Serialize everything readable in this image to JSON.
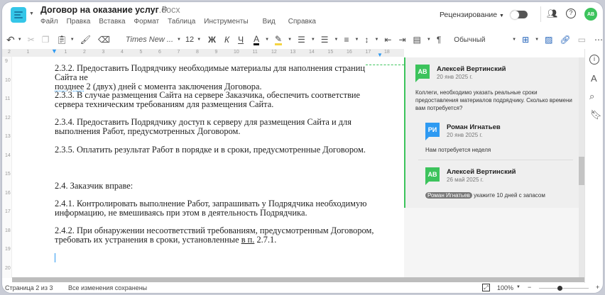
{
  "header": {
    "title": "Договор на оказание услуг",
    "ext": ".docx",
    "review_label": "Рецензирование",
    "user_initials": "АВ"
  },
  "menu": [
    "Файл",
    "Правка",
    "Вставка",
    "Формат",
    "Таблица",
    "Инструменты",
    "Вид",
    "Справка"
  ],
  "toolbar": {
    "font": "Times New ...",
    "size": "12",
    "bold": "Ж",
    "italic": "К",
    "underline": "Ч",
    "color_letter": "A",
    "style": "Обычный",
    "pilcrow": "¶"
  },
  "ruler": [
    "2",
    "1",
    "",
    "1",
    "2",
    "3",
    "4",
    "5",
    "6",
    "7",
    "8",
    "9",
    "10",
    "11",
    "12",
    "13",
    "14",
    "15",
    "16",
    "17",
    "18"
  ],
  "line_numbers": [
    "9",
    "10",
    "11",
    "12",
    "13",
    "14",
    "15",
    "16",
    "17",
    "18",
    "19",
    "20"
  ],
  "document": [
    "2.3.2. Предоставить Подрядчику необходимые материалы для наполнения страниц Сайта не ",
    "2 (двух) дней с момента заключения Договора.",
    "2.3.3. В случае размещения Сайта на сервере Заказчика, обеспечить соответствие сервера техническим требованиям для размещения Сайта.",
    "2.3.4. Предоставить Подрядчику доступ к серверу для размещения Сайта и для выполнения Работ, предусмотренных Договором.",
    "2.3.5. Оплатить результат Работ в порядке и в сроки, предусмотренные Договором.",
    "2.4. Заказчик вправе:",
    "2.4.1. Контролировать выполнение Работ, запрашивать у Подрядчика необходимую информацию, не вмешиваясь при этом в деятельность Подрядчика.",
    "2.4.2. При обнаружении несоответствий требованиям, предусмотренным Договором, требовать их устранения в сроки, установленные ",
    "в п.",
    " 2.7.1."
  ],
  "document_underlined": "позднее",
  "comments": [
    {
      "initials": "АВ",
      "author": "Алексей Вертинский",
      "date": "20 янв 2025 г.",
      "text": "Коллеги, необходимо указать реальные сроки предоставления материалов подрядчику. Сколько времени вам потребуется?",
      "color": "#3cc35c"
    },
    {
      "initials": "РИ",
      "author": "Роман Игнатьев",
      "date": "20 янв 2025 г.",
      "text": "Нам потребуется неделя",
      "color": "#2e9af2"
    },
    {
      "initials": "АВ",
      "author": "Алексей Вертинский",
      "date": "26 май 2025 г.",
      "mention": "Роман Игнатьев",
      "text": " укажите 10 дней с запасом",
      "color": "#3cc35c"
    }
  ],
  "status": {
    "page": "Страница 2 из 3",
    "saved": "Все изменения сохранены",
    "zoom": "100%",
    "zoom_slider_percent": 50
  }
}
